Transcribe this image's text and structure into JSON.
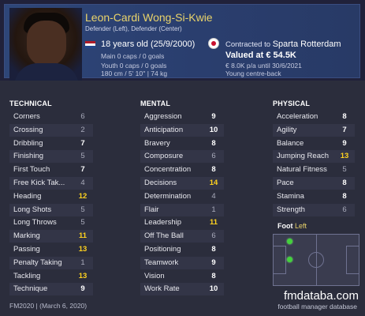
{
  "player": {
    "name": "Leon-Cardi Wong-Si-Kwie",
    "positions": "Defender (Left), Defender (Center)",
    "age": "18 years old (25/9/2000)",
    "caps_main": "Main 0 caps / 0 goals",
    "caps_youth": "Youth 0 caps / 0 goals",
    "height_weight": "180 cm / 5' 10'' | 74 kg",
    "contract_prefix": "Contracted to",
    "club": "Sparta Rotterdam",
    "value": "Valued at € 54.5K",
    "wage": "€ 8.0K p/a until 30/6/2021",
    "role": "Young centre-back",
    "flag_icon": "netherlands-flag-icon",
    "club_icon": "sparta-rotterdam-badge-icon"
  },
  "sections": {
    "technical": "TECHNICAL",
    "mental": "MENTAL",
    "physical": "PHYSICAL"
  },
  "technical": [
    {
      "label": "Corners",
      "value": "6"
    },
    {
      "label": "Crossing",
      "value": "2"
    },
    {
      "label": "Dribbling",
      "value": "7"
    },
    {
      "label": "Finishing",
      "value": "5"
    },
    {
      "label": "First Touch",
      "value": "7"
    },
    {
      "label": "Free Kick Tak...",
      "value": "4"
    },
    {
      "label": "Heading",
      "value": "12"
    },
    {
      "label": "Long Shots",
      "value": "5"
    },
    {
      "label": "Long Throws",
      "value": "5"
    },
    {
      "label": "Marking",
      "value": "11"
    },
    {
      "label": "Passing",
      "value": "13"
    },
    {
      "label": "Penalty Taking",
      "value": "1"
    },
    {
      "label": "Tackling",
      "value": "13"
    },
    {
      "label": "Technique",
      "value": "9"
    }
  ],
  "mental": [
    {
      "label": "Aggression",
      "value": "9"
    },
    {
      "label": "Anticipation",
      "value": "10"
    },
    {
      "label": "Bravery",
      "value": "8"
    },
    {
      "label": "Composure",
      "value": "6"
    },
    {
      "label": "Concentration",
      "value": "8"
    },
    {
      "label": "Decisions",
      "value": "14"
    },
    {
      "label": "Determination",
      "value": "4"
    },
    {
      "label": "Flair",
      "value": "1"
    },
    {
      "label": "Leadership",
      "value": "11"
    },
    {
      "label": "Off The Ball",
      "value": "6"
    },
    {
      "label": "Positioning",
      "value": "8"
    },
    {
      "label": "Teamwork",
      "value": "9"
    },
    {
      "label": "Vision",
      "value": "8"
    },
    {
      "label": "Work Rate",
      "value": "10"
    }
  ],
  "physical": [
    {
      "label": "Acceleration",
      "value": "8"
    },
    {
      "label": "Agility",
      "value": "7"
    },
    {
      "label": "Balance",
      "value": "9"
    },
    {
      "label": "Jumping Reach",
      "value": "13"
    },
    {
      "label": "Natural Fitness",
      "value": "5"
    },
    {
      "label": "Pace",
      "value": "8"
    },
    {
      "label": "Stamina",
      "value": "8"
    },
    {
      "label": "Strength",
      "value": "6"
    }
  ],
  "foot": {
    "label": "Foot",
    "value": "Left"
  },
  "footer": {
    "version": "FM2020 | (March 6, 2020)",
    "brand": "fmdataba.com",
    "brand_sub": "football manager database"
  },
  "colors": {
    "name": "#e9d36a",
    "high_attribute": "#ffd21f",
    "position_marker": "#43d13c"
  }
}
